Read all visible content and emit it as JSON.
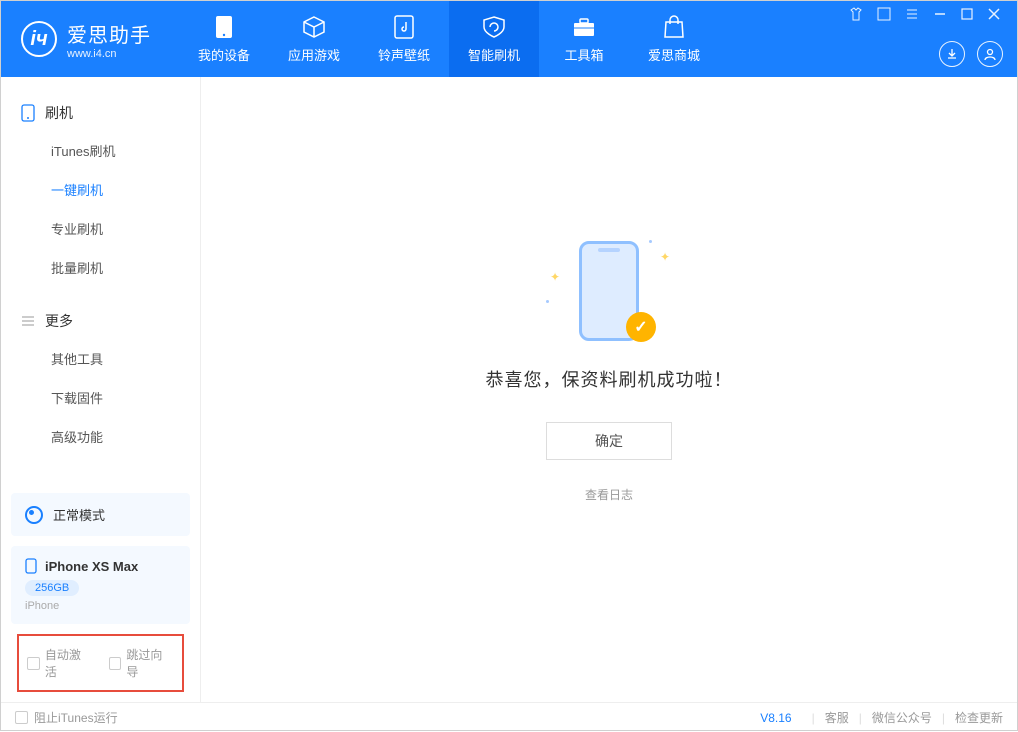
{
  "app": {
    "name": "爱思助手",
    "site": "www.i4.cn"
  },
  "nav": {
    "items": [
      {
        "label": "我的设备"
      },
      {
        "label": "应用游戏"
      },
      {
        "label": "铃声壁纸"
      },
      {
        "label": "智能刷机"
      },
      {
        "label": "工具箱"
      },
      {
        "label": "爱思商城"
      }
    ],
    "active_index": 3
  },
  "sidebar": {
    "groups": [
      {
        "title": "刷机",
        "items": [
          "iTunes刷机",
          "一键刷机",
          "专业刷机",
          "批量刷机"
        ],
        "active_index": 1
      },
      {
        "title": "更多",
        "items": [
          "其他工具",
          "下载固件",
          "高级功能"
        ],
        "active_index": -1
      }
    ],
    "mode": {
      "label": "正常模式"
    },
    "device": {
      "name": "iPhone XS Max",
      "storage": "256GB",
      "type": "iPhone"
    },
    "options": {
      "auto_activate": "自动激活",
      "skip_guide": "跳过向导"
    }
  },
  "main": {
    "success_msg": "恭喜您，保资料刷机成功啦！",
    "ok": "确定",
    "view_log": "查看日志"
  },
  "footer": {
    "block_itunes": "阻止iTunes运行",
    "version": "V8.16",
    "links": [
      "客服",
      "微信公众号",
      "检查更新"
    ]
  }
}
